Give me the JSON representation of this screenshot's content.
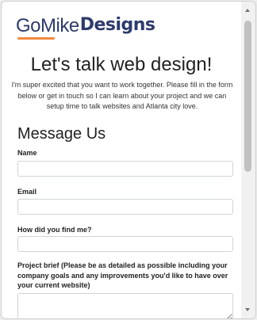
{
  "logo": {
    "part1": "GoMike",
    "part2": "Designs"
  },
  "headline": "Let's talk web design!",
  "intro": "I'm super excited that you want to work together. Please fill in the form below or get in touch so I can learn about your project and we can setup time to talk websites and Atlanta city love.",
  "form": {
    "title": "Message Us",
    "name_label": "Name",
    "name_value": "",
    "email_label": "Email",
    "email_value": "",
    "source_label": "How did you find me?",
    "source_value": "",
    "brief_label": "Project brief (Please be as detailed as possible including your company goals and any improvements you'd like to have over your current website)",
    "brief_value": ""
  },
  "colors": {
    "brand": "#2d3a6b",
    "accent": "#f2893c"
  },
  "icons": {
    "scroll_up": "triangle-up-icon",
    "scroll_down": "triangle-down-icon"
  }
}
